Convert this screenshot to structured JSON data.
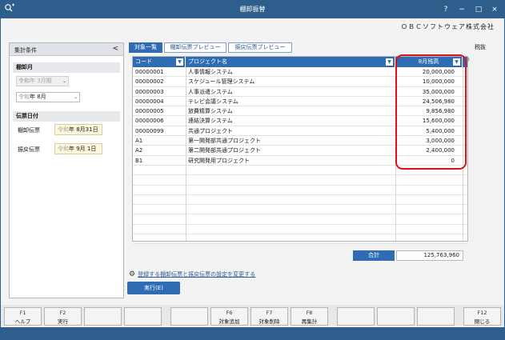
{
  "window": {
    "title": "棚卸振替",
    "company": "ＯＢＣソフトウェア株式会社",
    "controls": [
      "?",
      "−",
      "□",
      "×"
    ]
  },
  "left_panel": {
    "header": "集計条件",
    "collapse": "<",
    "section_month": "棚卸月",
    "period": {
      "era": "令和",
      "value": "年  3月期",
      "arrow": "⌄"
    },
    "month": {
      "era": "令和",
      "value": "年  8月",
      "arrow": "⌄"
    },
    "section_date": "伝票日付",
    "inventory_slip": {
      "label": "棚卸伝票",
      "era": "令和",
      "value": "年  8月31日"
    },
    "reversal_slip": {
      "label": "振戻伝票",
      "era": "令和",
      "value": "年  9月  1日"
    }
  },
  "tax_label": "税抜",
  "tabs": [
    "対象一覧",
    "棚卸伝票プレビュー",
    "振戻伝票プレビュー"
  ],
  "grid": {
    "headers": {
      "code": "コード",
      "project": "プロジェクト名",
      "amount": "8月残高"
    },
    "rows": [
      {
        "code": "00000001",
        "project": "人事情報システム",
        "amount": "20,000,000"
      },
      {
        "code": "00000002",
        "project": "スケジュール管理システム",
        "amount": "10,000,000"
      },
      {
        "code": "00000003",
        "project": "人事派遣システム",
        "amount": "35,000,000"
      },
      {
        "code": "00000004",
        "project": "テレビ会議システム",
        "amount": "24,506,980"
      },
      {
        "code": "00000005",
        "project": "旅費精算システム",
        "amount": "9,856,980"
      },
      {
        "code": "00000006",
        "project": "連結決算システム",
        "amount": "15,600,000"
      },
      {
        "code": "00000099",
        "project": "共通プロジェクト",
        "amount": "5,400,000"
      },
      {
        "code": "A1",
        "project": "第一開発部共通プロジェクト",
        "amount": "3,000,000"
      },
      {
        "code": "A2",
        "project": "第二開発部共通プロジェクト",
        "amount": "2,400,000"
      },
      {
        "code": "B1",
        "project": "研究開発用プロジェクト",
        "amount": "0"
      }
    ],
    "empty_rows": 8
  },
  "total": {
    "label": "合計",
    "value": "125,763,960"
  },
  "setting_link": "登録する棚卸伝票と振戻伝票の設定を変更する",
  "execute_button": "実行(E)",
  "function_keys": [
    {
      "key": "F1",
      "label": "ヘルプ"
    },
    {
      "key": "F2",
      "label": "実行"
    },
    {
      "key": "",
      "label": ""
    },
    {
      "key": "",
      "label": ""
    },
    {
      "key": "",
      "label": ""
    },
    {
      "key": "F6",
      "label": "対象追加"
    },
    {
      "key": "F7",
      "label": "対象削除"
    },
    {
      "key": "F8",
      "label": "再集計"
    },
    {
      "key": "",
      "label": ""
    },
    {
      "key": "",
      "label": ""
    },
    {
      "key": "",
      "label": ""
    },
    {
      "key": "F12",
      "label": "閉じる"
    }
  ]
}
